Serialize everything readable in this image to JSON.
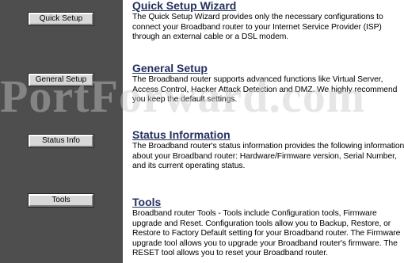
{
  "sidebar": {
    "buttons": [
      {
        "label": "Quick Setup"
      },
      {
        "label": "General Setup"
      },
      {
        "label": "Status Info"
      },
      {
        "label": "Tools"
      }
    ]
  },
  "sections": [
    {
      "title": "Quick Setup Wizard",
      "body": "The Quick Setup Wizard provides only the necessary configurations to connect your Broadband router to your Internet Service Provider (ISP) through an external cable or a DSL modem."
    },
    {
      "title": "General Setup",
      "body": "The Broadband router supports advanced functions like Virtual Server, Access Control, Hacker Attack Detection and DMZ. We highly recommend you keep the default settings."
    },
    {
      "title": "Status Information",
      "body": "The Broadband router's status information provides the following information about your Broadband router: Hardware/Firmware version, Serial Number, and its current operating status."
    },
    {
      "title": "Tools",
      "body": "Broadband router Tools - Tools include Configuration tools, Firmware upgrade and Reset. Configuration tools allow you to Backup, Restore, or Restore to Factory Default setting for your Broadband router. The Firmware upgrade tool allows you to upgrade your Broadband router's firmware. The RESET tool allows you to reset your Broadband router."
    }
  ],
  "watermark": "PortForward.com"
}
